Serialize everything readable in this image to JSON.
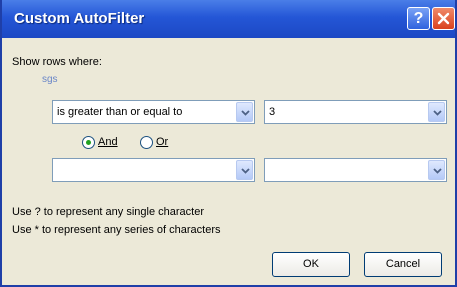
{
  "dialog": {
    "title": "Custom AutoFilter",
    "show_rows_label": "Show rows where:",
    "column_label": "sgs",
    "help_glyph": "?",
    "close_icon": "close-icon"
  },
  "criteria1": {
    "operator": "is greater than or equal to",
    "value": "3"
  },
  "logic": {
    "and_label": "And",
    "or_label": "Or",
    "selected": "And"
  },
  "criteria2": {
    "operator": "",
    "value": ""
  },
  "hints": {
    "line1": "Use ? to represent any single character",
    "line2": "Use * to represent any series of characters"
  },
  "buttons": {
    "ok": "OK",
    "cancel": "Cancel"
  },
  "colors": {
    "titlebar": "#2456d6",
    "dialog_bg": "#ece9d8",
    "close_red": "#d9411d",
    "radio_selected": "#21a121"
  }
}
